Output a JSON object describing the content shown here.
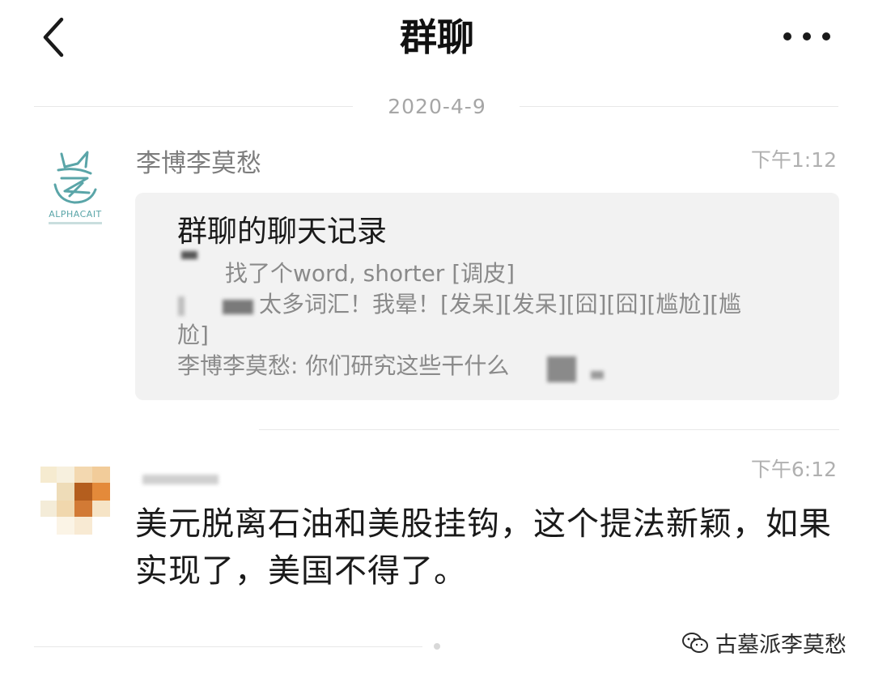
{
  "header": {
    "title": "群聊"
  },
  "date_separator": "2020-4-9",
  "messages": [
    {
      "sender": "李博李莫愁",
      "time": "下午1:12",
      "avatar_brand": "ALPHACAIT",
      "card": {
        "title": "群聊的聊天记录",
        "lines": [
          "找了个word, shorter [调皮]",
          "太多词汇！我晕！[发呆][发呆][囧][囧][尴尬][尴",
          "尬]",
          "李博李莫愁: 你们研究这些干什么"
        ]
      }
    },
    {
      "time": "下午6:12",
      "text": "美元脱离石油和美股挂钩，这个提法新颖，如果实现了，美国不得了。"
    }
  ],
  "watermark": "古墓派李莫愁",
  "icons": {
    "back": "chevron-left-icon",
    "more": "more-dots-icon",
    "avatar1": "alpha-cat-logo",
    "watermark": "wechat-icon"
  },
  "colors": {
    "accent_teal": "#5aa5a8",
    "card_bg": "#f2f2f2",
    "meta_text": "#a6a6a6"
  }
}
